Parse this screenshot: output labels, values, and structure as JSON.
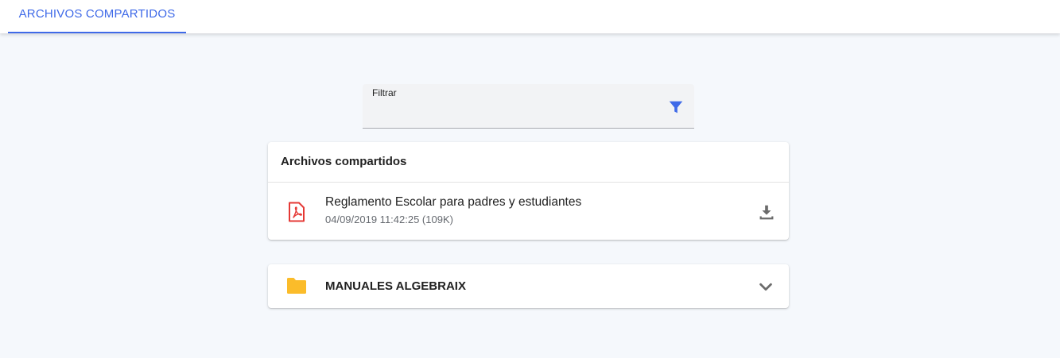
{
  "tabs": [
    {
      "label": "ARCHIVOS COMPARTIDOS",
      "active": true
    }
  ],
  "filter": {
    "label": "Filtrar",
    "value": "",
    "icon": "filter-icon"
  },
  "shared_files": {
    "title": "Archivos compartidos",
    "files": [
      {
        "name": "Reglamento Escolar para padres y estudiantes",
        "meta": "04/09/2019 11:42:25 (109K)",
        "icon": "pdf-icon",
        "action_icon": "download-icon"
      }
    ]
  },
  "folders": [
    {
      "name": "MANUALES ALGEBRAIX",
      "icon": "folder-icon",
      "expand_icon": "chevron-down-icon"
    }
  ],
  "colors": {
    "accent": "#3f6ae8",
    "background": "#f5f8fc",
    "pdf_red": "#e53935",
    "folder_yellow": "#fbbc2a",
    "icon_gray": "#6b6b6b"
  }
}
